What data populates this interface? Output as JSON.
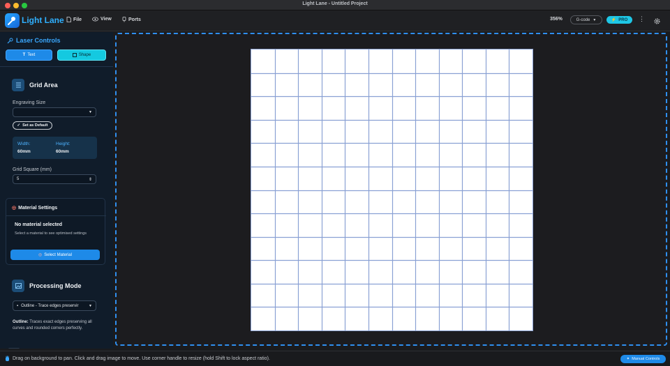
{
  "window": {
    "title": "Light Lane - Untitled Project"
  },
  "toolbar": {
    "brand": "Light Lane",
    "menu": [
      {
        "label": "File",
        "icon": "file-icon"
      },
      {
        "label": "View",
        "icon": "eye-icon"
      },
      {
        "label": "Ports",
        "icon": "port-icon"
      }
    ],
    "zoom": "356%",
    "output_format": "G-code",
    "pro_label": "PRO",
    "more_glyph": "⋮"
  },
  "sidebar": {
    "title": "Laser Controls",
    "mode_buttons": {
      "text_label": "Text",
      "shape_label": "Shape"
    },
    "grid_area": {
      "title": "Grid Area",
      "engraving_size_label": "Engraving Size",
      "engraving_size_value": "",
      "set_default_label": "Set as Default",
      "width_label": "Width:",
      "width_value": "60mm",
      "height_label": "Height:",
      "height_value": "60mm",
      "grid_square_label": "Grid Square (mm)",
      "grid_square_value": "5"
    },
    "material": {
      "title": "Material Settings",
      "empty_title": "No material selected",
      "empty_desc": "Select a material to see optimised settings",
      "select_label": "Select Material"
    },
    "processing": {
      "title": "Processing Mode",
      "selected": "Outline - Trace edges preservir",
      "desc_label": "Outline:",
      "desc_text": " Traces exact edges preserving all curves and rounded corners perfectly."
    }
  },
  "canvas": {
    "grid_cells": 12
  },
  "status": {
    "hint": "Drag on background to pan. Click and drag image to move. Use corner handle to resize (hold Shift to lock aspect ratio).",
    "manual_controls_label": "Manual Controls"
  },
  "colors": {
    "accent": "#2fb0ff",
    "primary_button": "#1e8ae8",
    "cyan_button": "#14c9e0",
    "grid_line": "#8aa1d4"
  }
}
